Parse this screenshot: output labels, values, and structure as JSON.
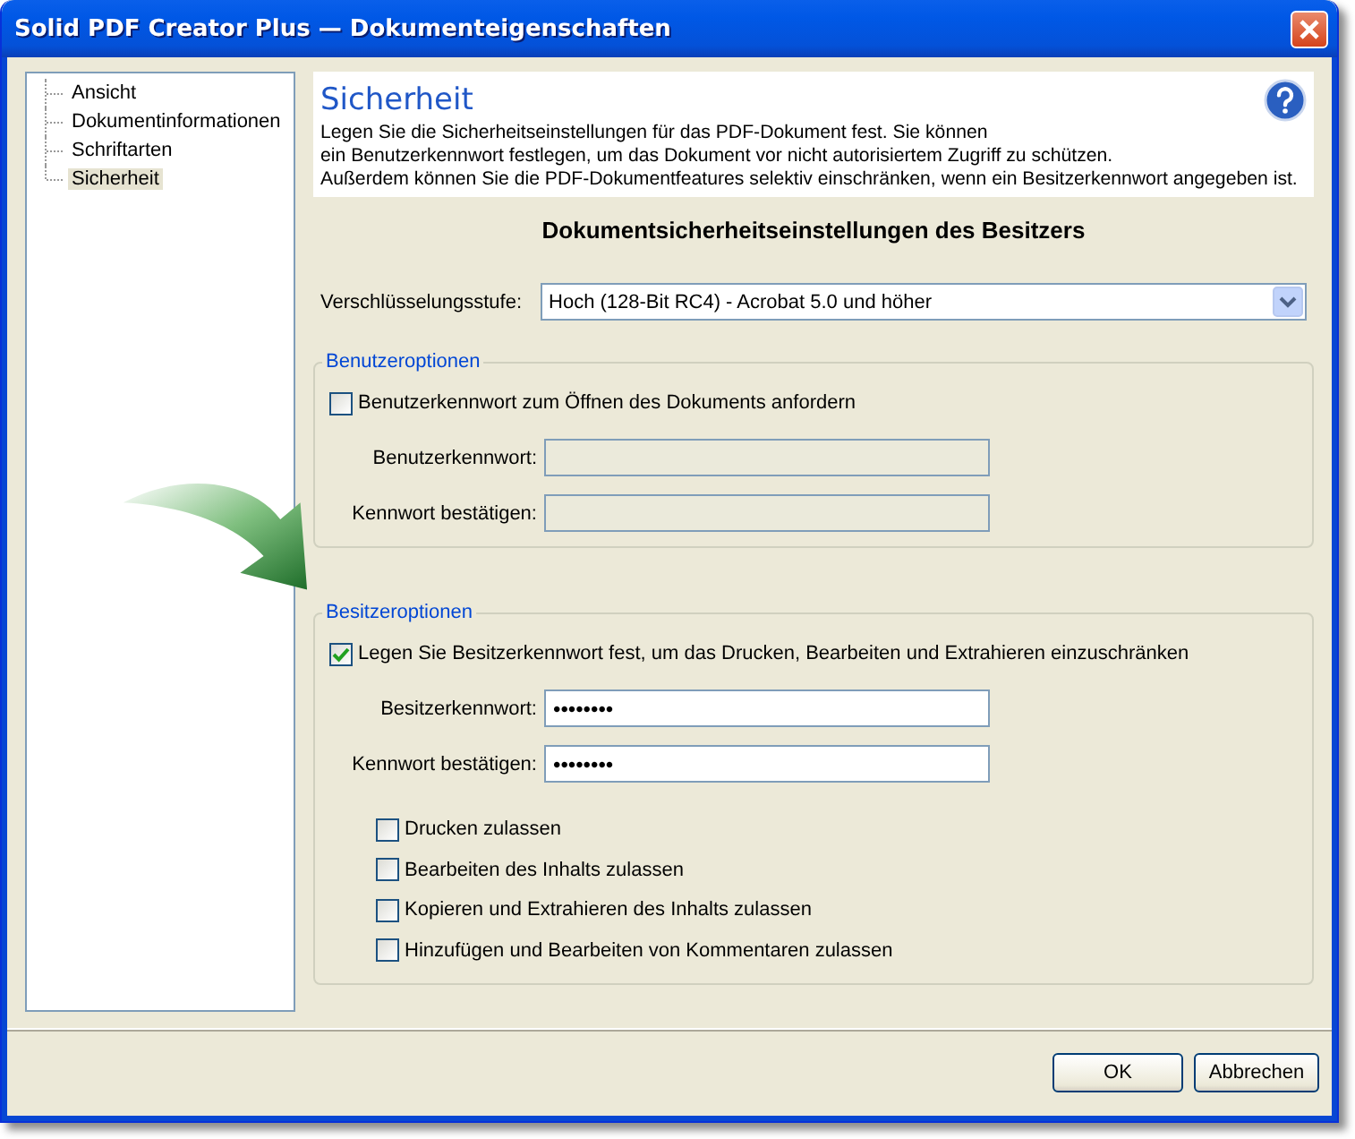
{
  "window": {
    "title": "Solid PDF Creator Plus — Dokumenteigenschaften"
  },
  "sidebar": {
    "items": [
      {
        "label": "Ansicht",
        "selected": false
      },
      {
        "label": "Dokumentinformationen",
        "selected": false
      },
      {
        "label": "Schriftarten",
        "selected": false
      },
      {
        "label": "Sicherheit",
        "selected": true
      }
    ]
  },
  "header": {
    "title": "Sicherheit",
    "description": [
      "Legen Sie die Sicherheitseinstellungen für das PDF-Dokument fest. Sie können",
      "ein Benutzerkennwort festlegen, um das Dokument vor nicht autorisiertem Zugriff zu schützen.",
      "Außerdem können Sie die PDF-Dokumentfeatures selektiv einschränken, wenn ein Besitzerkennwort angegeben ist."
    ]
  },
  "section_title": "Dokumentsicherheitseinstellungen des Besitzers",
  "encryption": {
    "label": "Verschlüsselungsstufe:",
    "value": "Hoch (128-Bit RC4) - Acrobat 5.0 und höher"
  },
  "groups": [
    {
      "title": "Benutzeroptionen",
      "checkbox": {
        "label": "Benutzerkennwort zum Öffnen des Dokuments anfordern",
        "checked": false
      },
      "fields": [
        {
          "label": "Benutzerkennwort:",
          "disabled": true
        },
        {
          "label": "Kennwort bestätigen:",
          "disabled": true
        }
      ]
    },
    {
      "title": "Besitzeroptionen",
      "checkbox": {
        "label": "Legen Sie Besitzerkennwort fest, um das Drucken, Bearbeiten und Extrahieren einzuschränken",
        "checked": true
      },
      "fields": [
        {
          "label": "Besitzerkennwort:",
          "value": "••••••••",
          "disabled": false
        },
        {
          "label": "Kennwort bestätigen:",
          "value": "••••••••",
          "disabled": false
        }
      ],
      "permissions": [
        {
          "label": "Drucken zulassen",
          "checked": false
        },
        {
          "label": "Bearbeiten des Inhalts zulassen",
          "checked": false
        },
        {
          "label": "Kopieren und Extrahieren des Inhalts zulassen",
          "checked": false
        },
        {
          "label": "Hinzufügen und Bearbeiten von Kommentaren zulassen",
          "checked": false
        }
      ]
    }
  ],
  "buttons": [
    "OK",
    "Abbrechen"
  ]
}
